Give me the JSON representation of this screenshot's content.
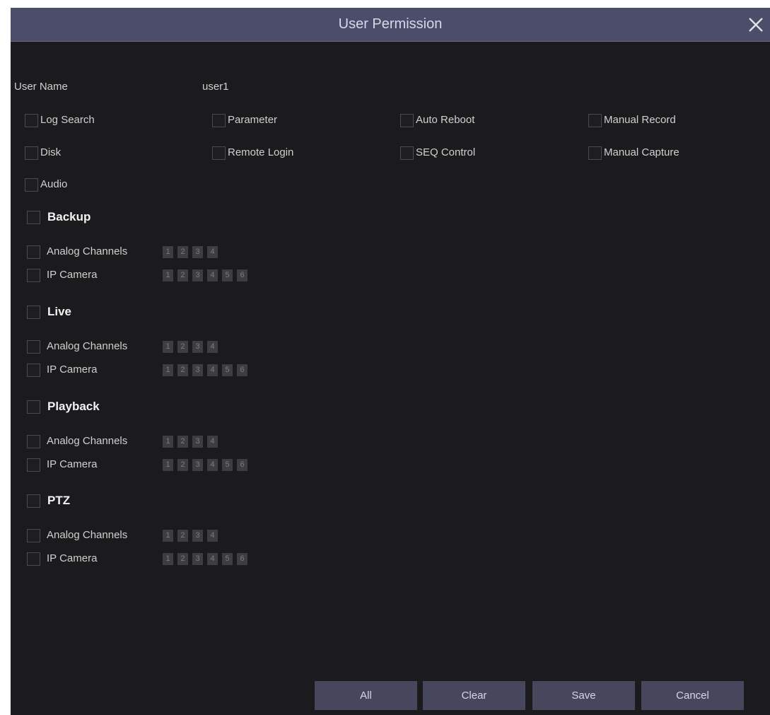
{
  "dialog": {
    "title": "User Permission",
    "close_icon": "close-icon"
  },
  "user": {
    "label": "User Name",
    "value": "user1"
  },
  "permissions": [
    {
      "label": "Log Search",
      "checked": false
    },
    {
      "label": "Parameter",
      "checked": false
    },
    {
      "label": "Auto Reboot",
      "checked": false
    },
    {
      "label": "Manual Record",
      "checked": false
    },
    {
      "label": "Disk",
      "checked": false
    },
    {
      "label": "Remote Login",
      "checked": false
    },
    {
      "label": "SEQ Control",
      "checked": false
    },
    {
      "label": "Manual Capture",
      "checked": false
    },
    {
      "label": "Audio",
      "checked": false
    }
  ],
  "sections": [
    {
      "title": "Backup",
      "checked": false,
      "analog": {
        "label": "Analog Channels",
        "channels": [
          "1",
          "2",
          "3",
          "4"
        ]
      },
      "ip": {
        "label": "IP Camera",
        "channels": [
          "1",
          "2",
          "3",
          "4",
          "5",
          "6"
        ]
      }
    },
    {
      "title": "Live",
      "checked": false,
      "analog": {
        "label": "Analog Channels",
        "channels": [
          "1",
          "2",
          "3",
          "4"
        ]
      },
      "ip": {
        "label": "IP Camera",
        "channels": [
          "1",
          "2",
          "3",
          "4",
          "5",
          "6"
        ]
      }
    },
    {
      "title": "Playback",
      "checked": false,
      "analog": {
        "label": "Analog Channels",
        "channels": [
          "1",
          "2",
          "3",
          "4"
        ]
      },
      "ip": {
        "label": "IP Camera",
        "channels": [
          "1",
          "2",
          "3",
          "4",
          "5",
          "6"
        ]
      }
    },
    {
      "title": "PTZ",
      "checked": false,
      "analog": {
        "label": "Analog Channels",
        "channels": [
          "1",
          "2",
          "3",
          "4"
        ]
      },
      "ip": {
        "label": "IP Camera",
        "channels": [
          "1",
          "2",
          "3",
          "4",
          "5",
          "6"
        ]
      }
    }
  ],
  "buttons": {
    "all": "All",
    "clear": "Clear",
    "save": "Save",
    "cancel": "Cancel"
  },
  "colors": {
    "titlebar": "#4b4d6a",
    "panel": "#1b1b1d",
    "button": "#46475c"
  }
}
